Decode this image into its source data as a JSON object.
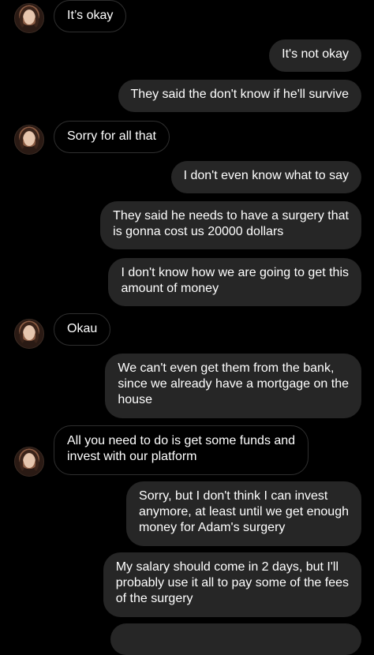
{
  "messages": [
    {
      "sender": "them",
      "text": "It’s okay"
    },
    {
      "sender": "me",
      "text": "It's not okay"
    },
    {
      "sender": "me",
      "text": "They said the don't know if he'll survive"
    },
    {
      "sender": "them",
      "text": "Sorry for all that"
    },
    {
      "sender": "me",
      "text": "I don't even know what to say"
    },
    {
      "sender": "me",
      "text": "They said he needs to have a surgery that\nis gonna cost us 20000 dollars"
    },
    {
      "sender": "me",
      "text": "I don't know how we are going to get this\namount of money"
    },
    {
      "sender": "them",
      "text": "Okau"
    },
    {
      "sender": "me",
      "text": "We can't even get them from the bank,\nsince we already have a mortgage on the\nhouse"
    },
    {
      "sender": "them",
      "text": "All you need to do is get some funds and\ninvest with our platform"
    },
    {
      "sender": "me",
      "text": "Sorry, but I don't think I can invest\nanymore, at least until we get enough\nmoney for Adam's surgery"
    },
    {
      "sender": "me",
      "text": "My salary should come in 2 days, but I'll\nprobably use it all to pay some of the fees\nof the surgery"
    }
  ],
  "colors": {
    "background": "#000000",
    "incoming_bubble_border": "#2f2f2f",
    "outgoing_bubble": "#262626",
    "text": "#ffffff"
  },
  "icons": {
    "avatar": "contact-avatar"
  }
}
